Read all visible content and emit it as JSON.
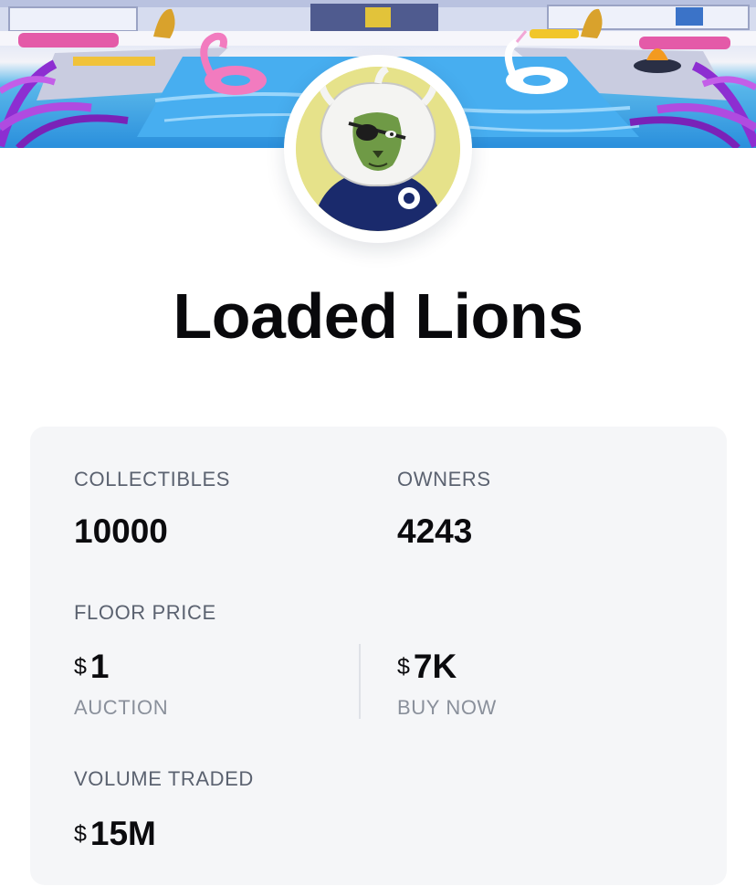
{
  "collection": {
    "name": "Loaded Lions"
  },
  "stats": {
    "collectibles": {
      "label": "COLLECTIBLES",
      "value": "10000"
    },
    "owners": {
      "label": "OWNERS",
      "value": "4243"
    },
    "floor_price": {
      "label": "FLOOR PRICE",
      "auction": {
        "currency": "$",
        "value": "1",
        "label": "AUCTION"
      },
      "buy_now": {
        "currency": "$",
        "value": "7K",
        "label": "BUY NOW"
      }
    },
    "volume_traded": {
      "label": "VOLUME TRADED",
      "currency": "$",
      "value": "15M"
    }
  },
  "icons": {
    "banner": "pool-party-illustration",
    "avatar": "lion-avatar"
  },
  "colors": {
    "card_background": "#f5f6f8",
    "label_text": "#5b6270",
    "sublabel_text": "#8a909b",
    "avatar_background": "#e6e28a",
    "pool_blue": "#2a8fdc"
  }
}
